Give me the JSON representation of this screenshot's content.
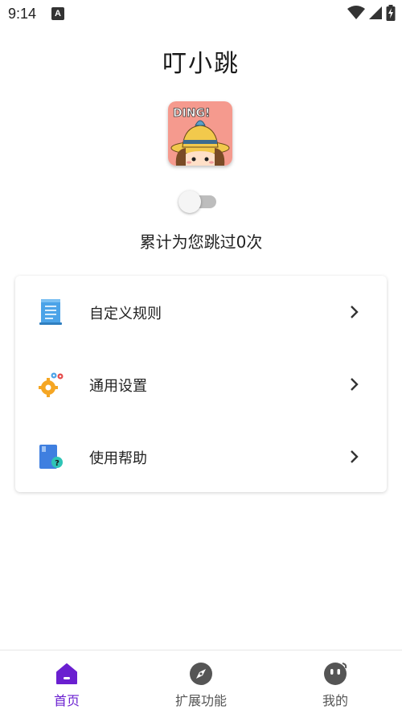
{
  "status_bar": {
    "time": "9:14",
    "notification_icon": "a-icon"
  },
  "app": {
    "title": "叮小跳"
  },
  "main": {
    "toggle_on": false,
    "skip_count_text": "累计为您跳过0次"
  },
  "menu": {
    "items": [
      {
        "label": "自定义规则",
        "icon": "document-icon"
      },
      {
        "label": "通用设置",
        "icon": "gears-icon"
      },
      {
        "label": "使用帮助",
        "icon": "help-book-icon"
      }
    ]
  },
  "bottom_nav": {
    "items": [
      {
        "label": "首页",
        "icon": "home-icon",
        "active": true
      },
      {
        "label": "扩展功能",
        "icon": "compass-icon",
        "active": false
      },
      {
        "label": "我的",
        "icon": "face-icon",
        "active": false
      }
    ]
  },
  "colors": {
    "accent": "#6a1fd0",
    "inactive": "#555555",
    "logo_background": "#f59a8e"
  }
}
